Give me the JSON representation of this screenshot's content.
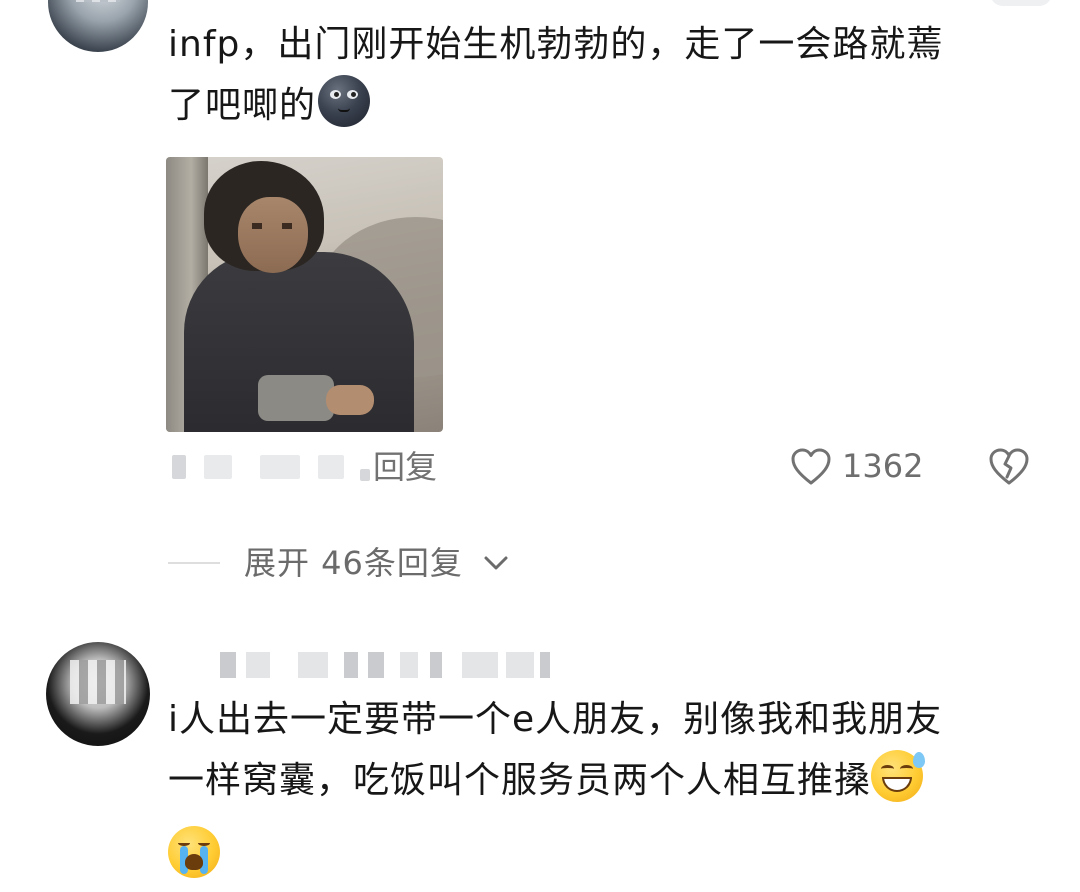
{
  "comments": [
    {
      "text_lines": [
        "infp，出门刚开始生机勃勃的，走了一会路就蔫",
        "了吧唧的"
      ],
      "trailing_emoji": "moon-face-icon",
      "has_image": true,
      "reply_label": "回复",
      "like_count": "1362"
    },
    {
      "text_lines": [
        "i人出去一定要带一个e人朋友，别像我和我朋友",
        "一样窝囊，吃饭叫个服务员两个人相互推搡"
      ],
      "trailing_emojis": [
        "sweat-smile-icon",
        "crying-face-icon"
      ]
    }
  ],
  "expand_replies_label": "展开 46条回复",
  "colors": {
    "text": "#171717",
    "meta": "#727272",
    "divider": "#dedede"
  }
}
